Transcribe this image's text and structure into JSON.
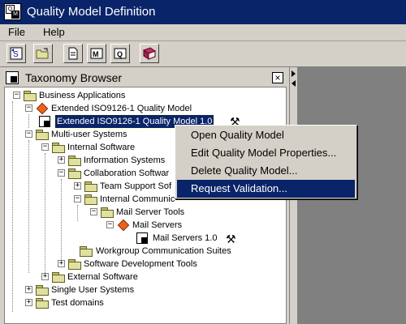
{
  "window": {
    "title": "Quality Model Definition"
  },
  "menu": [
    {
      "label": "File"
    },
    {
      "label": "Help"
    }
  ],
  "toolbar": {
    "buttons": [
      {
        "icon": "refresh-model-icon"
      },
      {
        "icon": "open-folder-icon"
      },
      {
        "icon": "document-icon"
      },
      {
        "icon": "model-m-icon"
      },
      {
        "icon": "model-q-icon"
      },
      {
        "icon": "book-icon"
      }
    ]
  },
  "panel": {
    "title": "Taxonomy Browser",
    "close": "×"
  },
  "tree": {
    "nodes": [
      {
        "label": "Business Applications"
      },
      {
        "label": "Extended ISO9126-1 Quality Model"
      },
      {
        "label": "Extended ISO9126-1 Quality Model 1.0"
      },
      {
        "label": "Multi-user Systems"
      },
      {
        "label": "Internal Software"
      },
      {
        "label": "Information Systems"
      },
      {
        "label": "Collaboration Softwar"
      },
      {
        "label": "Team Support Sof"
      },
      {
        "label": "Internal Communic"
      },
      {
        "label": "Mail Server Tools"
      },
      {
        "label": "Mail Servers"
      },
      {
        "label": "Mail Servers 1.0"
      },
      {
        "label": "Workgroup Communication Suites"
      },
      {
        "label": "Software Development Tools"
      },
      {
        "label": "External Software"
      },
      {
        "label": "Single User Systems"
      },
      {
        "label": "Test domains"
      }
    ],
    "expander_open": "−",
    "expander_closed": "+",
    "tool_icon": "hammer-icon"
  },
  "context_menu": {
    "items": [
      {
        "label": "Open Quality Model"
      },
      {
        "label": "Edit Quality Model Properties..."
      },
      {
        "label": "Delete Quality Model..."
      },
      {
        "label": "Request Validation..."
      }
    ]
  },
  "colors": {
    "titlebar": "#0a246a",
    "selection": "#0a246a",
    "chrome": "#d4d0c8",
    "workspace": "#808080"
  }
}
